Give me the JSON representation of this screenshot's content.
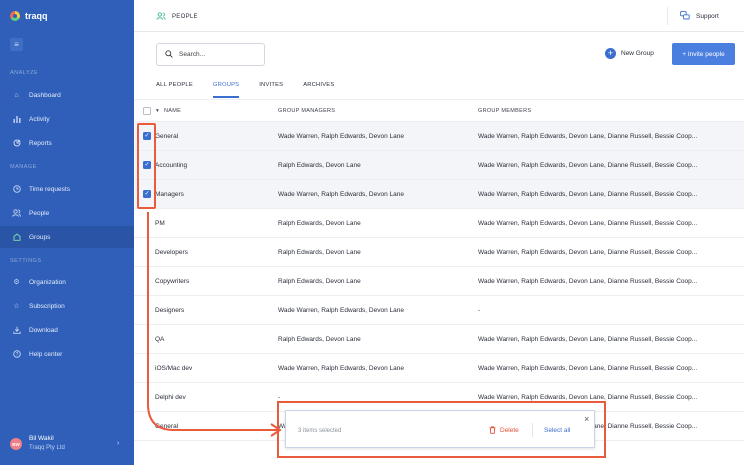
{
  "app": {
    "name": "traqq"
  },
  "sidebar": {
    "sections": [
      {
        "title": "ANALYZE",
        "items": [
          {
            "label": "Dashboard",
            "icon": "home-icon"
          },
          {
            "label": "Activity",
            "icon": "bar-chart-icon"
          },
          {
            "label": "Reports",
            "icon": "reports-icon"
          }
        ]
      },
      {
        "title": "MANAGE",
        "items": [
          {
            "label": "Time requests",
            "icon": "clock-icon"
          },
          {
            "label": "People",
            "icon": "people-icon"
          },
          {
            "label": "Groups",
            "icon": "groups-icon",
            "active": true
          }
        ]
      },
      {
        "title": "SETTINGS",
        "items": [
          {
            "label": "Organization",
            "icon": "gear-icon"
          },
          {
            "label": "Subscription",
            "icon": "star-icon"
          },
          {
            "label": "Download",
            "icon": "download-icon"
          },
          {
            "label": "Help center",
            "icon": "help-icon"
          }
        ]
      }
    ],
    "user": {
      "initials": "BW",
      "name": "Bil Wakil",
      "org": "Traqq Pty Ltd"
    }
  },
  "header": {
    "title": "PEOPLE",
    "support_label": "Support"
  },
  "toolbar": {
    "search_placeholder": "Search...",
    "new_group_label": "New Group",
    "invite_label": "+ Invite people"
  },
  "tabs": [
    {
      "label": "ALL PEOPLE",
      "active": false
    },
    {
      "label": "GROUPS",
      "active": true
    },
    {
      "label": "INVITES",
      "active": false
    },
    {
      "label": "ARCHIVES",
      "active": false
    }
  ],
  "table": {
    "columns": {
      "name": "NAME",
      "managers": "GROUP MANAGERS",
      "members": "GROUP MEMBERS"
    },
    "rows": [
      {
        "name": "General",
        "managers": "Wade Warren, Ralph Edwards, Devon Lane",
        "members": "Wade Warren, Ralph Edwards, Devon Lane, Dianne Russell, Bessie Coop...",
        "checked": true
      },
      {
        "name": "Accounting",
        "managers": "Ralph Edwards, Devon Lane",
        "members": "Wade Warren, Ralph Edwards, Devon Lane, Dianne Russell, Bessie Coop...",
        "checked": true
      },
      {
        "name": "Managers",
        "managers": "Wade Warren, Ralph Edwards, Devon Lane",
        "members": "Wade Warren, Ralph Edwards, Devon Lane, Dianne Russell, Bessie Coop...",
        "checked": true
      },
      {
        "name": "PM",
        "managers": "Ralph Edwards, Devon Lane",
        "members": "Wade Warren, Ralph Edwards, Devon Lane, Dianne Russell, Bessie Coop..."
      },
      {
        "name": "Developers",
        "managers": "Ralph Edwards, Devon Lane",
        "members": "Wade Warren, Ralph Edwards, Devon Lane, Dianne Russell, Bessie Coop..."
      },
      {
        "name": "Copywriters",
        "managers": "Ralph Edwards, Devon Lane",
        "members": "Wade Warren, Ralph Edwards, Devon Lane, Dianne Russell, Bessie Coop..."
      },
      {
        "name": "Designers",
        "managers": "Wade Warren, Ralph Edwards, Devon Lane",
        "members": "-"
      },
      {
        "name": "QA",
        "managers": "Ralph Edwards, Devon Lane",
        "members": "Wade Warren, Ralph Edwards, Devon Lane, Dianne Russell, Bessie Coop..."
      },
      {
        "name": "iOS/Mac dev",
        "managers": "Wade Warren, Ralph Edwards, Devon Lane",
        "members": "Wade Warren, Ralph Edwards, Devon Lane, Dianne Russell, Bessie Coop..."
      },
      {
        "name": "Delphi dev",
        "managers": "-",
        "members": "Wade Warren, Ralph Edwards, Devon Lane, Dianne Russell, Bessie Coop..."
      },
      {
        "name": "General",
        "managers": "Wade Warren, Ralph Edwards, Devon Lane",
        "members": "Wade Warren, Ralph Edwards, Devon Lane, Dianne Russell, Bessie Coop..."
      }
    ]
  },
  "selection_bar": {
    "count_text": "3 items selected",
    "delete_label": "Delete",
    "select_all_label": "Select all"
  },
  "colors": {
    "sidebar": "#2f5fb8",
    "accent": "#3a6fd0",
    "annotation": "#ea5a3c",
    "danger": "#e2513a"
  }
}
